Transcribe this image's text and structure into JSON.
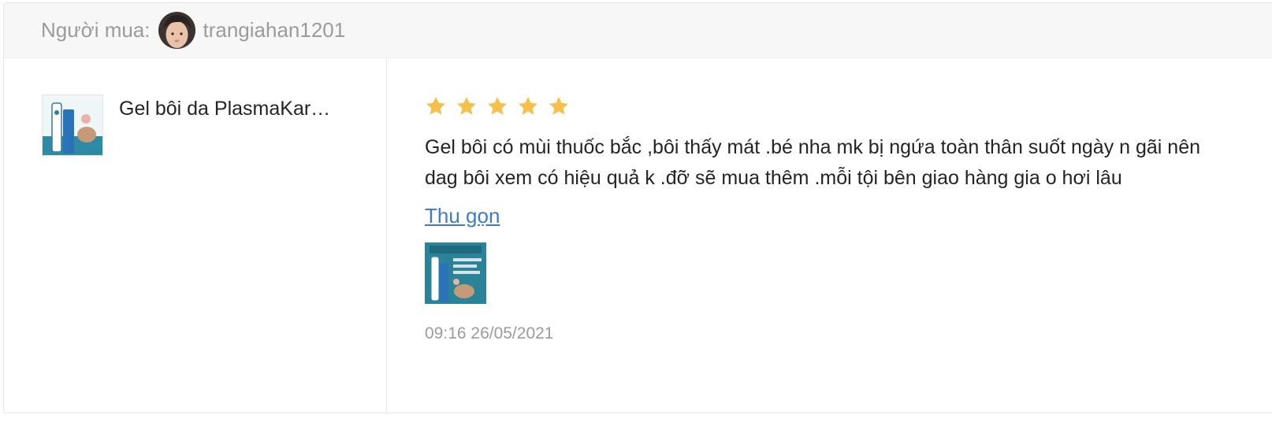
{
  "buyer": {
    "label": "Người mua:",
    "username": "trangiahan1201",
    "avatar_icon": "user-avatar-photo"
  },
  "product": {
    "name": "Gel bôi da PlasmaKar…",
    "thumbnail_icon": "plasmakare-gel-tube-image"
  },
  "review": {
    "rating": 5,
    "max_rating": 5,
    "star_color": "#f6c04a",
    "text": "Gel bôi có mùi thuốc bắc ,bôi thấy mát .bé nha mk bị ngứa toàn thân suốt ngày n gãi nên dag bôi xem có hiệu quả k .đỡ sẽ mua thêm .mỗi tội bên giao hàng gia o hơi lâu",
    "collapse_label": "Thu gọn",
    "image_icon": "review-photo-plasmakare",
    "timestamp": "09:16 26/05/2021"
  },
  "colors": {
    "link": "#3b7bd6",
    "muted": "#9b9b9b",
    "text": "#242424",
    "header_bg": "#f7f7f7"
  }
}
